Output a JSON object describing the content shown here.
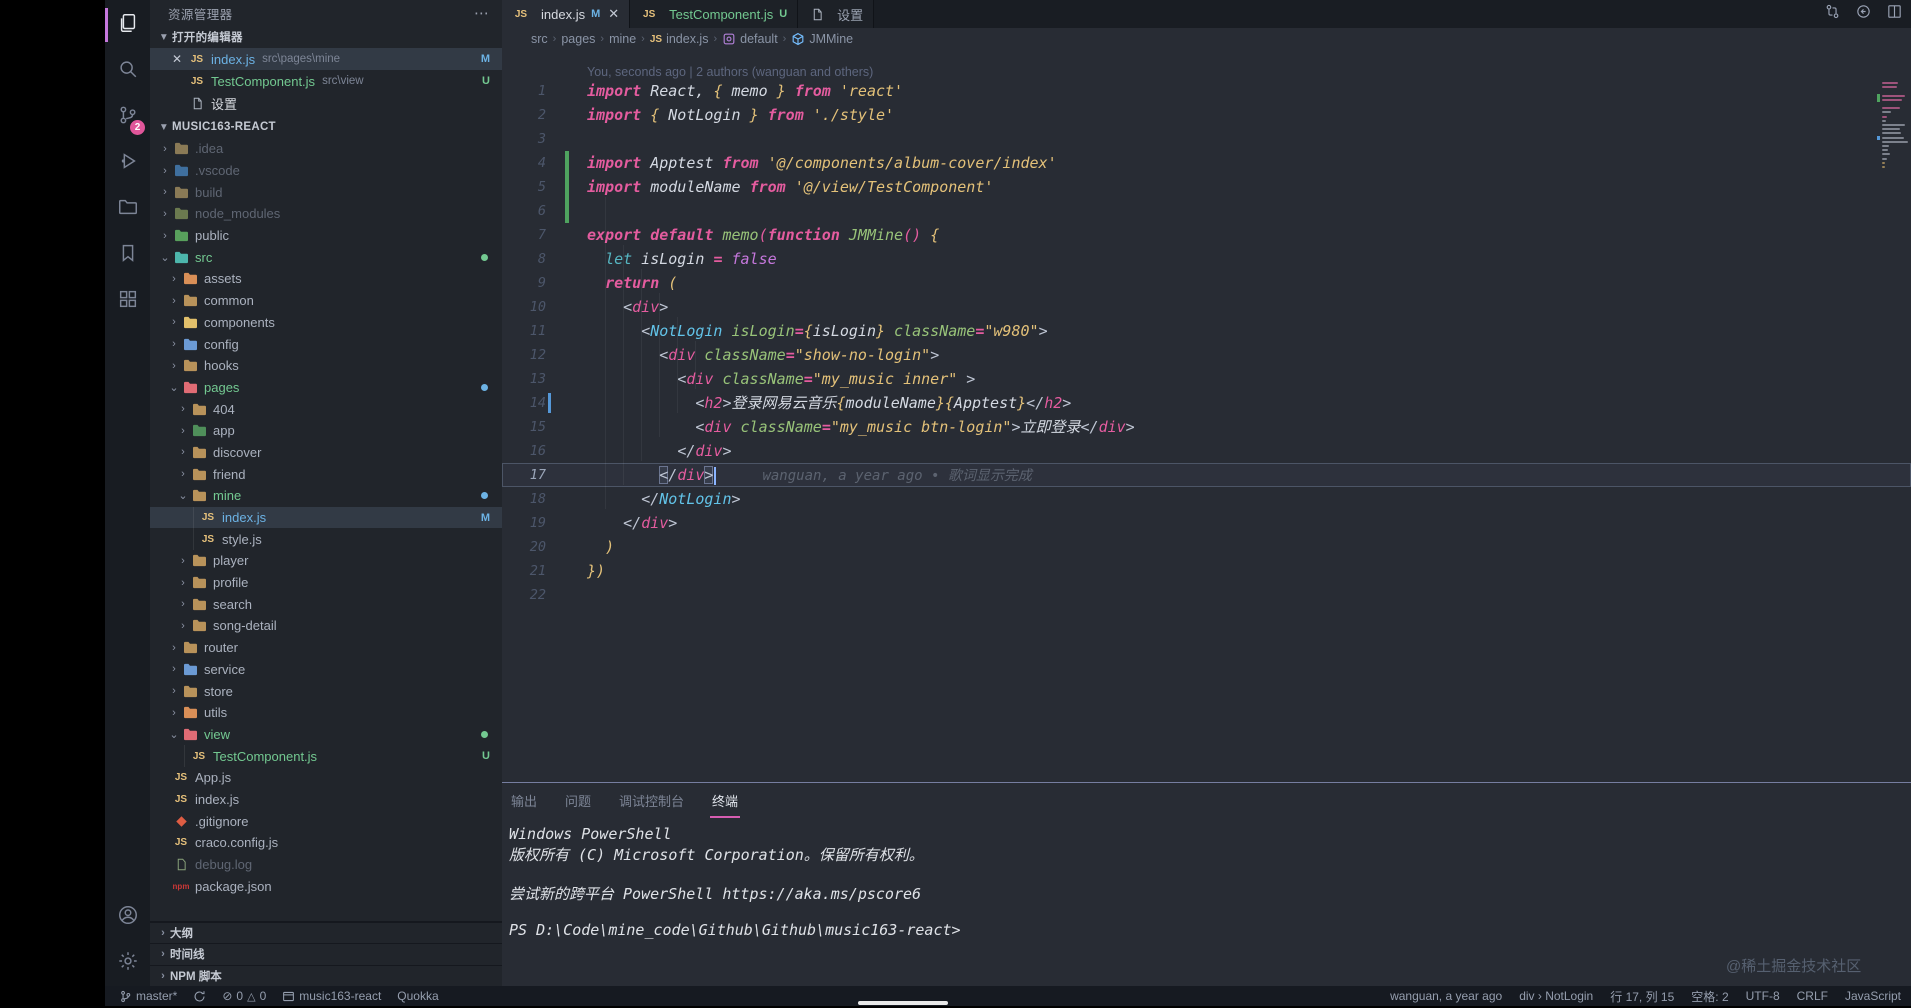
{
  "activity_bar": {
    "top": [
      {
        "name": "explorer",
        "icon": "files",
        "active": true
      },
      {
        "name": "search",
        "icon": "search"
      },
      {
        "name": "source-control",
        "icon": "scm",
        "badge": "2"
      },
      {
        "name": "run-debug",
        "icon": "debug"
      },
      {
        "name": "file-folders",
        "icon": "folder"
      },
      {
        "name": "bookmarks",
        "icon": "bookmark"
      },
      {
        "name": "extensions",
        "icon": "grid"
      }
    ],
    "bottom": [
      {
        "name": "account",
        "icon": "account"
      },
      {
        "name": "settings",
        "icon": "gear"
      }
    ]
  },
  "sidebar": {
    "title": "资源管理器",
    "open_editors": {
      "header": "打开的编辑器",
      "items": [
        {
          "label": "index.js",
          "path": "src\\pages\\mine",
          "icon": "js",
          "badge": "M",
          "status": "m",
          "selected": true,
          "close": true
        },
        {
          "label": "TestComponent.js",
          "path": "src\\view",
          "icon": "js",
          "badge": "U",
          "status": "u"
        },
        {
          "label": "设置",
          "icon": "page",
          "status": "n"
        }
      ]
    },
    "project": {
      "header": "MUSIC163-REACT",
      "tree": [
        {
          "label": ".idea",
          "level": 0,
          "chev": "c",
          "icon": "folder",
          "color": "#8a7a56",
          "status": "dim"
        },
        {
          "label": ".vscode",
          "level": 0,
          "chev": "c",
          "icon": "folder",
          "color": "#3f6f9e",
          "status": "dim"
        },
        {
          "label": "build",
          "level": 0,
          "chev": "c",
          "icon": "folder",
          "color": "#8a7a56",
          "status": "dim"
        },
        {
          "label": "node_modules",
          "level": 0,
          "chev": "c",
          "icon": "folder",
          "color": "#6b7a4f",
          "status": "dim"
        },
        {
          "label": "public",
          "level": 0,
          "chev": "c",
          "icon": "folder",
          "color": "#58a05c",
          "status": "n"
        },
        {
          "label": "src",
          "level": 0,
          "chev": "o",
          "icon": "folder",
          "color": "#4db6ac",
          "status": "u",
          "dot": "#73c991"
        },
        {
          "label": "assets",
          "level": 1,
          "chev": "c",
          "icon": "folder",
          "color": "#d98f57",
          "status": "n"
        },
        {
          "label": "common",
          "level": 1,
          "chev": "c",
          "icon": "folder",
          "color": "#b8925a",
          "status": "n"
        },
        {
          "label": "components",
          "level": 1,
          "chev": "c",
          "icon": "folder",
          "color": "#e2c06b",
          "status": "n"
        },
        {
          "label": "config",
          "level": 1,
          "chev": "c",
          "icon": "folder",
          "color": "#6b9ad4",
          "status": "n"
        },
        {
          "label": "hooks",
          "level": 1,
          "chev": "c",
          "icon": "folder",
          "color": "#b8925a",
          "status": "n"
        },
        {
          "label": "pages",
          "level": 1,
          "chev": "o",
          "icon": "folder",
          "color": "#e06c75",
          "status": "u",
          "dot": "#6cb2e4"
        },
        {
          "label": "404",
          "level": 2,
          "chev": "c",
          "icon": "folder",
          "color": "#b8925a",
          "status": "n"
        },
        {
          "label": "app",
          "level": 2,
          "chev": "c",
          "icon": "folder",
          "color": "#4f8f5a",
          "status": "n"
        },
        {
          "label": "discover",
          "level": 2,
          "chev": "c",
          "icon": "folder",
          "color": "#b8925a",
          "status": "n"
        },
        {
          "label": "friend",
          "level": 2,
          "chev": "c",
          "icon": "folder",
          "color": "#b8925a",
          "status": "n"
        },
        {
          "label": "mine",
          "level": 2,
          "chev": "o",
          "icon": "folder",
          "color": "#b8925a",
          "status": "u",
          "dot": "#6cb2e4"
        },
        {
          "label": "index.js",
          "level": 3,
          "file": true,
          "icon": "js",
          "status": "m",
          "badge": "M",
          "selected": true,
          "guide": true
        },
        {
          "label": "style.js",
          "level": 3,
          "file": true,
          "icon": "js",
          "status": "n",
          "guide": true
        },
        {
          "label": "player",
          "level": 2,
          "chev": "c",
          "icon": "folder",
          "color": "#b8925a",
          "status": "n"
        },
        {
          "label": "profile",
          "level": 2,
          "chev": "c",
          "icon": "folder",
          "color": "#b8925a",
          "status": "n"
        },
        {
          "label": "search",
          "level": 2,
          "chev": "c",
          "icon": "folder",
          "color": "#b8925a",
          "status": "n"
        },
        {
          "label": "song-detail",
          "level": 2,
          "chev": "c",
          "icon": "folder",
          "color": "#b8925a",
          "status": "n"
        },
        {
          "label": "router",
          "level": 1,
          "chev": "c",
          "icon": "folder",
          "color": "#b8925a",
          "status": "n"
        },
        {
          "label": "service",
          "level": 1,
          "chev": "c",
          "icon": "folder",
          "color": "#6b9ad4",
          "status": "n"
        },
        {
          "label": "store",
          "level": 1,
          "chev": "c",
          "icon": "folder",
          "color": "#b8925a",
          "status": "n"
        },
        {
          "label": "utils",
          "level": 1,
          "chev": "c",
          "icon": "folder",
          "color": "#d98f57",
          "status": "n"
        },
        {
          "label": "view",
          "level": 1,
          "chev": "o",
          "icon": "folder",
          "color": "#e06c75",
          "status": "u",
          "dot": "#73c991"
        },
        {
          "label": "TestComponent.js",
          "level": 2,
          "file": true,
          "icon": "js",
          "status": "u",
          "badge": "U",
          "guide": true
        },
        {
          "label": "App.js",
          "level": 0,
          "file": true,
          "icon": "js",
          "status": "n"
        },
        {
          "label": "index.js",
          "level": 0,
          "file": true,
          "icon": "js",
          "status": "n"
        },
        {
          "label": ".gitignore",
          "level": 0,
          "file": true,
          "icon": "git",
          "status": "n"
        },
        {
          "label": "craco.config.js",
          "level": 0,
          "file": true,
          "icon": "js",
          "status": "n"
        },
        {
          "label": "debug.log",
          "level": 0,
          "file": true,
          "icon": "log",
          "status": "dim"
        },
        {
          "label": "package.json",
          "level": 0,
          "file": true,
          "icon": "npm",
          "status": "n"
        }
      ]
    },
    "bottom_sections": [
      "大纲",
      "时间线",
      "NPM 脚本"
    ]
  },
  "editor": {
    "tabs": [
      {
        "label": "index.js",
        "icon": "js",
        "badge": "M",
        "badge_color": "#6cb2e4",
        "close": true,
        "active": true,
        "color": "#d7dae0"
      },
      {
        "label": "TestComponent.js",
        "icon": "js",
        "badge": "U",
        "badge_color": "#73c991",
        "color": "#73c991"
      },
      {
        "label": "设置",
        "icon": "page",
        "color": "#9aa2b1"
      }
    ],
    "actions": [
      "git-compare",
      "open-changes",
      "split-editor"
    ],
    "breadcrumbs": [
      {
        "label": "src"
      },
      {
        "label": "pages"
      },
      {
        "label": "mine"
      },
      {
        "label": "index.js",
        "icon": "js"
      },
      {
        "label": "default",
        "icon": "symbol"
      },
      {
        "label": "JMMine",
        "icon": "module"
      }
    ],
    "codelens": "You, seconds ago | 2 authors (wanguan and others)",
    "blame_line17": "wanguan, a year ago • 歌词显示完成",
    "cursor": {
      "line": 17,
      "col": 15
    },
    "code_lines": [
      {
        "n": 1,
        "t": [
          [
            "kw",
            "import"
          ],
          [
            "pl",
            " React, "
          ],
          [
            "br",
            "{"
          ],
          [
            "pl",
            " memo "
          ],
          [
            "br",
            "}"
          ],
          [
            "kw",
            " from"
          ],
          [
            "st",
            " 'react'"
          ]
        ]
      },
      {
        "n": 2,
        "t": [
          [
            "kw",
            "import"
          ],
          [
            "pl",
            " "
          ],
          [
            "br",
            "{"
          ],
          [
            "pl",
            " NotLogin "
          ],
          [
            "br",
            "}"
          ],
          [
            "kw",
            " from"
          ],
          [
            "st",
            " './style'"
          ]
        ]
      },
      {
        "n": 3,
        "t": []
      },
      {
        "n": 4,
        "gutter": "add",
        "t": [
          [
            "kw",
            "import"
          ],
          [
            "pl",
            " Apptest "
          ],
          [
            "kw",
            "from"
          ],
          [
            "st",
            " '@/components/album-cover/index'"
          ]
        ]
      },
      {
        "n": 5,
        "gutter": "add",
        "t": [
          [
            "kw",
            "import"
          ],
          [
            "pl",
            " moduleName "
          ],
          [
            "kw",
            "from"
          ],
          [
            "st",
            " '@/view/TestComponent'"
          ]
        ]
      },
      {
        "n": 6,
        "gutter": "add",
        "t": []
      },
      {
        "n": 7,
        "t": [
          [
            "kw",
            "export"
          ],
          [
            "pl",
            " "
          ],
          [
            "kw",
            "default"
          ],
          [
            "pl",
            " "
          ],
          [
            "fn",
            "memo"
          ],
          [
            "pk",
            "("
          ],
          [
            "kw",
            "function"
          ],
          [
            "pl",
            " "
          ],
          [
            "fn",
            "JMMine"
          ],
          [
            "pk",
            "()"
          ],
          [
            "pl",
            " "
          ],
          [
            "br",
            "{"
          ]
        ]
      },
      {
        "n": 8,
        "t": [
          [
            "pl",
            "  "
          ],
          [
            "lt",
            "let"
          ],
          [
            "pl",
            " isLogin "
          ],
          [
            "kw",
            "="
          ],
          [
            "pl",
            " "
          ],
          [
            "bo",
            "false"
          ]
        ]
      },
      {
        "n": 9,
        "t": [
          [
            "pl",
            "  "
          ],
          [
            "kw",
            "return"
          ],
          [
            "pl",
            " "
          ],
          [
            "br",
            "("
          ]
        ]
      },
      {
        "n": 10,
        "t": [
          [
            "pl",
            "    "
          ],
          [
            "pu",
            "<"
          ],
          [
            "tg",
            "div"
          ],
          [
            "pu",
            ">"
          ]
        ]
      },
      {
        "n": 11,
        "t": [
          [
            "pl",
            "      "
          ],
          [
            "pu",
            "<"
          ],
          [
            "cp",
            "NotLogin"
          ],
          [
            "at",
            " isLogin"
          ],
          [
            "kw",
            "="
          ],
          [
            "br",
            "{"
          ],
          [
            "pl",
            "isLogin"
          ],
          [
            "br",
            "}"
          ],
          [
            "at",
            " className"
          ],
          [
            "kw",
            "="
          ],
          [
            "st",
            "\"w980\""
          ],
          [
            "pu",
            ">"
          ]
        ]
      },
      {
        "n": 12,
        "t": [
          [
            "pl",
            "        "
          ],
          [
            "pu",
            "<"
          ],
          [
            "tg",
            "div"
          ],
          [
            "at",
            " className"
          ],
          [
            "kw",
            "="
          ],
          [
            "st",
            "\"show-no-login\""
          ],
          [
            "pu",
            ">"
          ]
        ]
      },
      {
        "n": 13,
        "t": [
          [
            "pl",
            "          "
          ],
          [
            "pu",
            "<"
          ],
          [
            "tg",
            "div"
          ],
          [
            "at",
            " className"
          ],
          [
            "kw",
            "="
          ],
          [
            "st",
            "\"my_music inner\""
          ],
          [
            "pu",
            " >"
          ]
        ]
      },
      {
        "n": 14,
        "gutter": "mod",
        "t": [
          [
            "pl",
            "            "
          ],
          [
            "pu",
            "<"
          ],
          [
            "tg",
            "h2"
          ],
          [
            "pu",
            ">"
          ],
          [
            "pl",
            "登录网易云音乐"
          ],
          [
            "br",
            "{"
          ],
          [
            "pl",
            "moduleName"
          ],
          [
            "br",
            "}"
          ],
          [
            "br",
            "{"
          ],
          [
            "pl",
            "Apptest"
          ],
          [
            "br",
            "}"
          ],
          [
            "pu",
            "</"
          ],
          [
            "tg",
            "h2"
          ],
          [
            "pu",
            ">"
          ]
        ]
      },
      {
        "n": 15,
        "t": [
          [
            "pl",
            "            "
          ],
          [
            "pu",
            "<"
          ],
          [
            "tg",
            "div"
          ],
          [
            "at",
            " className"
          ],
          [
            "kw",
            "="
          ],
          [
            "st",
            "\"my_music btn-login\""
          ],
          [
            "pu",
            ">"
          ],
          [
            "pl",
            "立即登录"
          ],
          [
            "pu",
            "</"
          ],
          [
            "tg",
            "div"
          ],
          [
            "pu",
            ">"
          ]
        ]
      },
      {
        "n": 16,
        "t": [
          [
            "pl",
            "          "
          ],
          [
            "pu",
            "</"
          ],
          [
            "tg",
            "div"
          ],
          [
            "pu",
            ">"
          ]
        ]
      },
      {
        "n": 17,
        "current": true,
        "t": [
          [
            "pl",
            "        "
          ],
          [
            "pu bm",
            "<"
          ],
          [
            "pu",
            "/"
          ],
          [
            "tg",
            "div"
          ],
          [
            "pu bm",
            ">"
          ],
          [
            "cur",
            ""
          ]
        ]
      },
      {
        "n": 18,
        "t": [
          [
            "pl",
            "      "
          ],
          [
            "pu",
            "</"
          ],
          [
            "cp",
            "NotLogin"
          ],
          [
            "pu",
            ">"
          ]
        ]
      },
      {
        "n": 19,
        "t": [
          [
            "pl",
            "    "
          ],
          [
            "pu",
            "</"
          ],
          [
            "tg",
            "div"
          ],
          [
            "pu",
            ">"
          ]
        ]
      },
      {
        "n": 20,
        "t": [
          [
            "pl",
            "  "
          ],
          [
            "br",
            ")"
          ]
        ]
      },
      {
        "n": 21,
        "t": [
          [
            "br",
            "}"
          ],
          [
            "br",
            ")"
          ]
        ]
      },
      {
        "n": 22,
        "t": []
      }
    ]
  },
  "panel": {
    "tabs": [
      {
        "label": "输出"
      },
      {
        "label": "问题"
      },
      {
        "label": "调试控制台"
      },
      {
        "label": "终端",
        "active": true
      }
    ],
    "terminal_lines": [
      "Windows PowerShell",
      "版权所有 (C) Microsoft Corporation。保留所有权利。",
      "",
      "尝试新的跨平台 PowerShell https://aka.ms/pscore6",
      "",
      "PS D:\\Code\\mine_code\\Github\\Github\\music163-react>"
    ]
  },
  "status_bar": {
    "left": [
      {
        "icon": "branch",
        "label": "master*",
        "name": "git-branch"
      },
      {
        "icon": "sync",
        "label": "",
        "name": "sync"
      },
      {
        "icon": "errwarn",
        "label": "0  0",
        "name": "problems"
      },
      {
        "icon": "window",
        "label": "music163-react",
        "name": "project"
      },
      {
        "icon": "",
        "label": "Quokka",
        "name": "quokka"
      }
    ],
    "right": [
      {
        "label": "wanguan, a year ago",
        "name": "gitlens-blame"
      },
      {
        "label": "div › NotLogin",
        "name": "element-path"
      },
      {
        "label": "行 17, 列 15",
        "name": "cursor-position"
      },
      {
        "label": "空格: 2",
        "name": "indentation"
      },
      {
        "label": "UTF-8",
        "name": "encoding"
      },
      {
        "label": "CRLF",
        "name": "eol"
      },
      {
        "label": "JavaScript",
        "name": "language-mode"
      }
    ]
  },
  "watermark": "@稀土掘金技术社区"
}
